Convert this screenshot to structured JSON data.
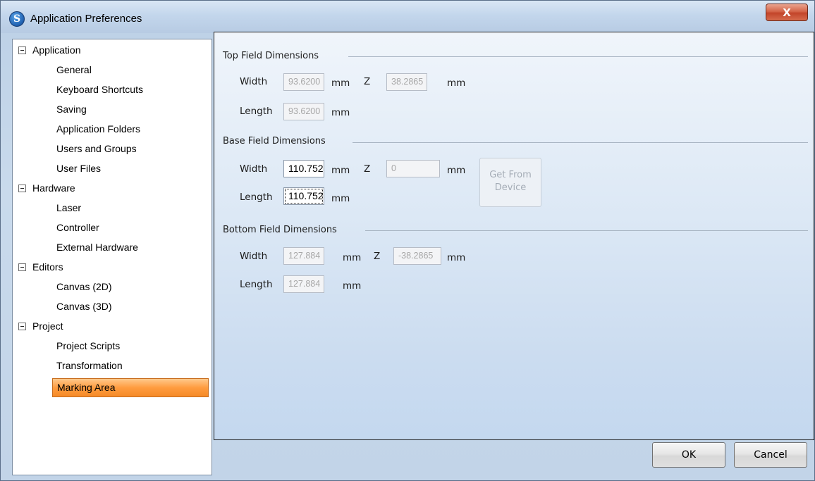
{
  "window": {
    "title": "Application Preferences",
    "close_glyph": "X"
  },
  "tree": {
    "groups": [
      {
        "label": "Application",
        "items": [
          "General",
          "Keyboard Shortcuts",
          "Saving",
          "Application Folders",
          "Users and Groups",
          "User Files"
        ]
      },
      {
        "label": "Hardware",
        "items": [
          "Laser",
          "Controller",
          "External Hardware"
        ]
      },
      {
        "label": "Editors",
        "items": [
          "Canvas (2D)",
          "Canvas (3D)"
        ]
      },
      {
        "label": "Project",
        "items": [
          "Project Scripts",
          "Transformation",
          "Marking Area"
        ]
      }
    ],
    "selected": "Marking Area"
  },
  "top_field": {
    "title": "Top Field Dimensions",
    "width_label": "Width",
    "width_value": "93.6200",
    "width_unit": "mm",
    "z_label": "Z",
    "z_value": "38.2865",
    "z_unit": "mm",
    "length_label": "Length",
    "length_value": "93.6200",
    "length_unit": "mm"
  },
  "base_field": {
    "title": "Base Field Dimensions",
    "width_label": "Width",
    "width_value": "110.752",
    "width_unit": "mm",
    "z_label": "Z",
    "z_value": "0",
    "z_unit": "mm",
    "length_label": "Length",
    "length_value": "110.752",
    "length_unit": "mm",
    "get_button_line1": "Get From",
    "get_button_line2": "Device"
  },
  "bottom_field": {
    "title": "Bottom Field Dimensions",
    "width_label": "Width",
    "width_value": "127.884",
    "width_unit": "mm",
    "z_label": "Z",
    "z_value": "-38.2865",
    "z_unit": "mm",
    "length_label": "Length",
    "length_value": "127.884",
    "length_unit": "mm"
  },
  "buttons": {
    "ok": "OK",
    "cancel": "Cancel"
  }
}
